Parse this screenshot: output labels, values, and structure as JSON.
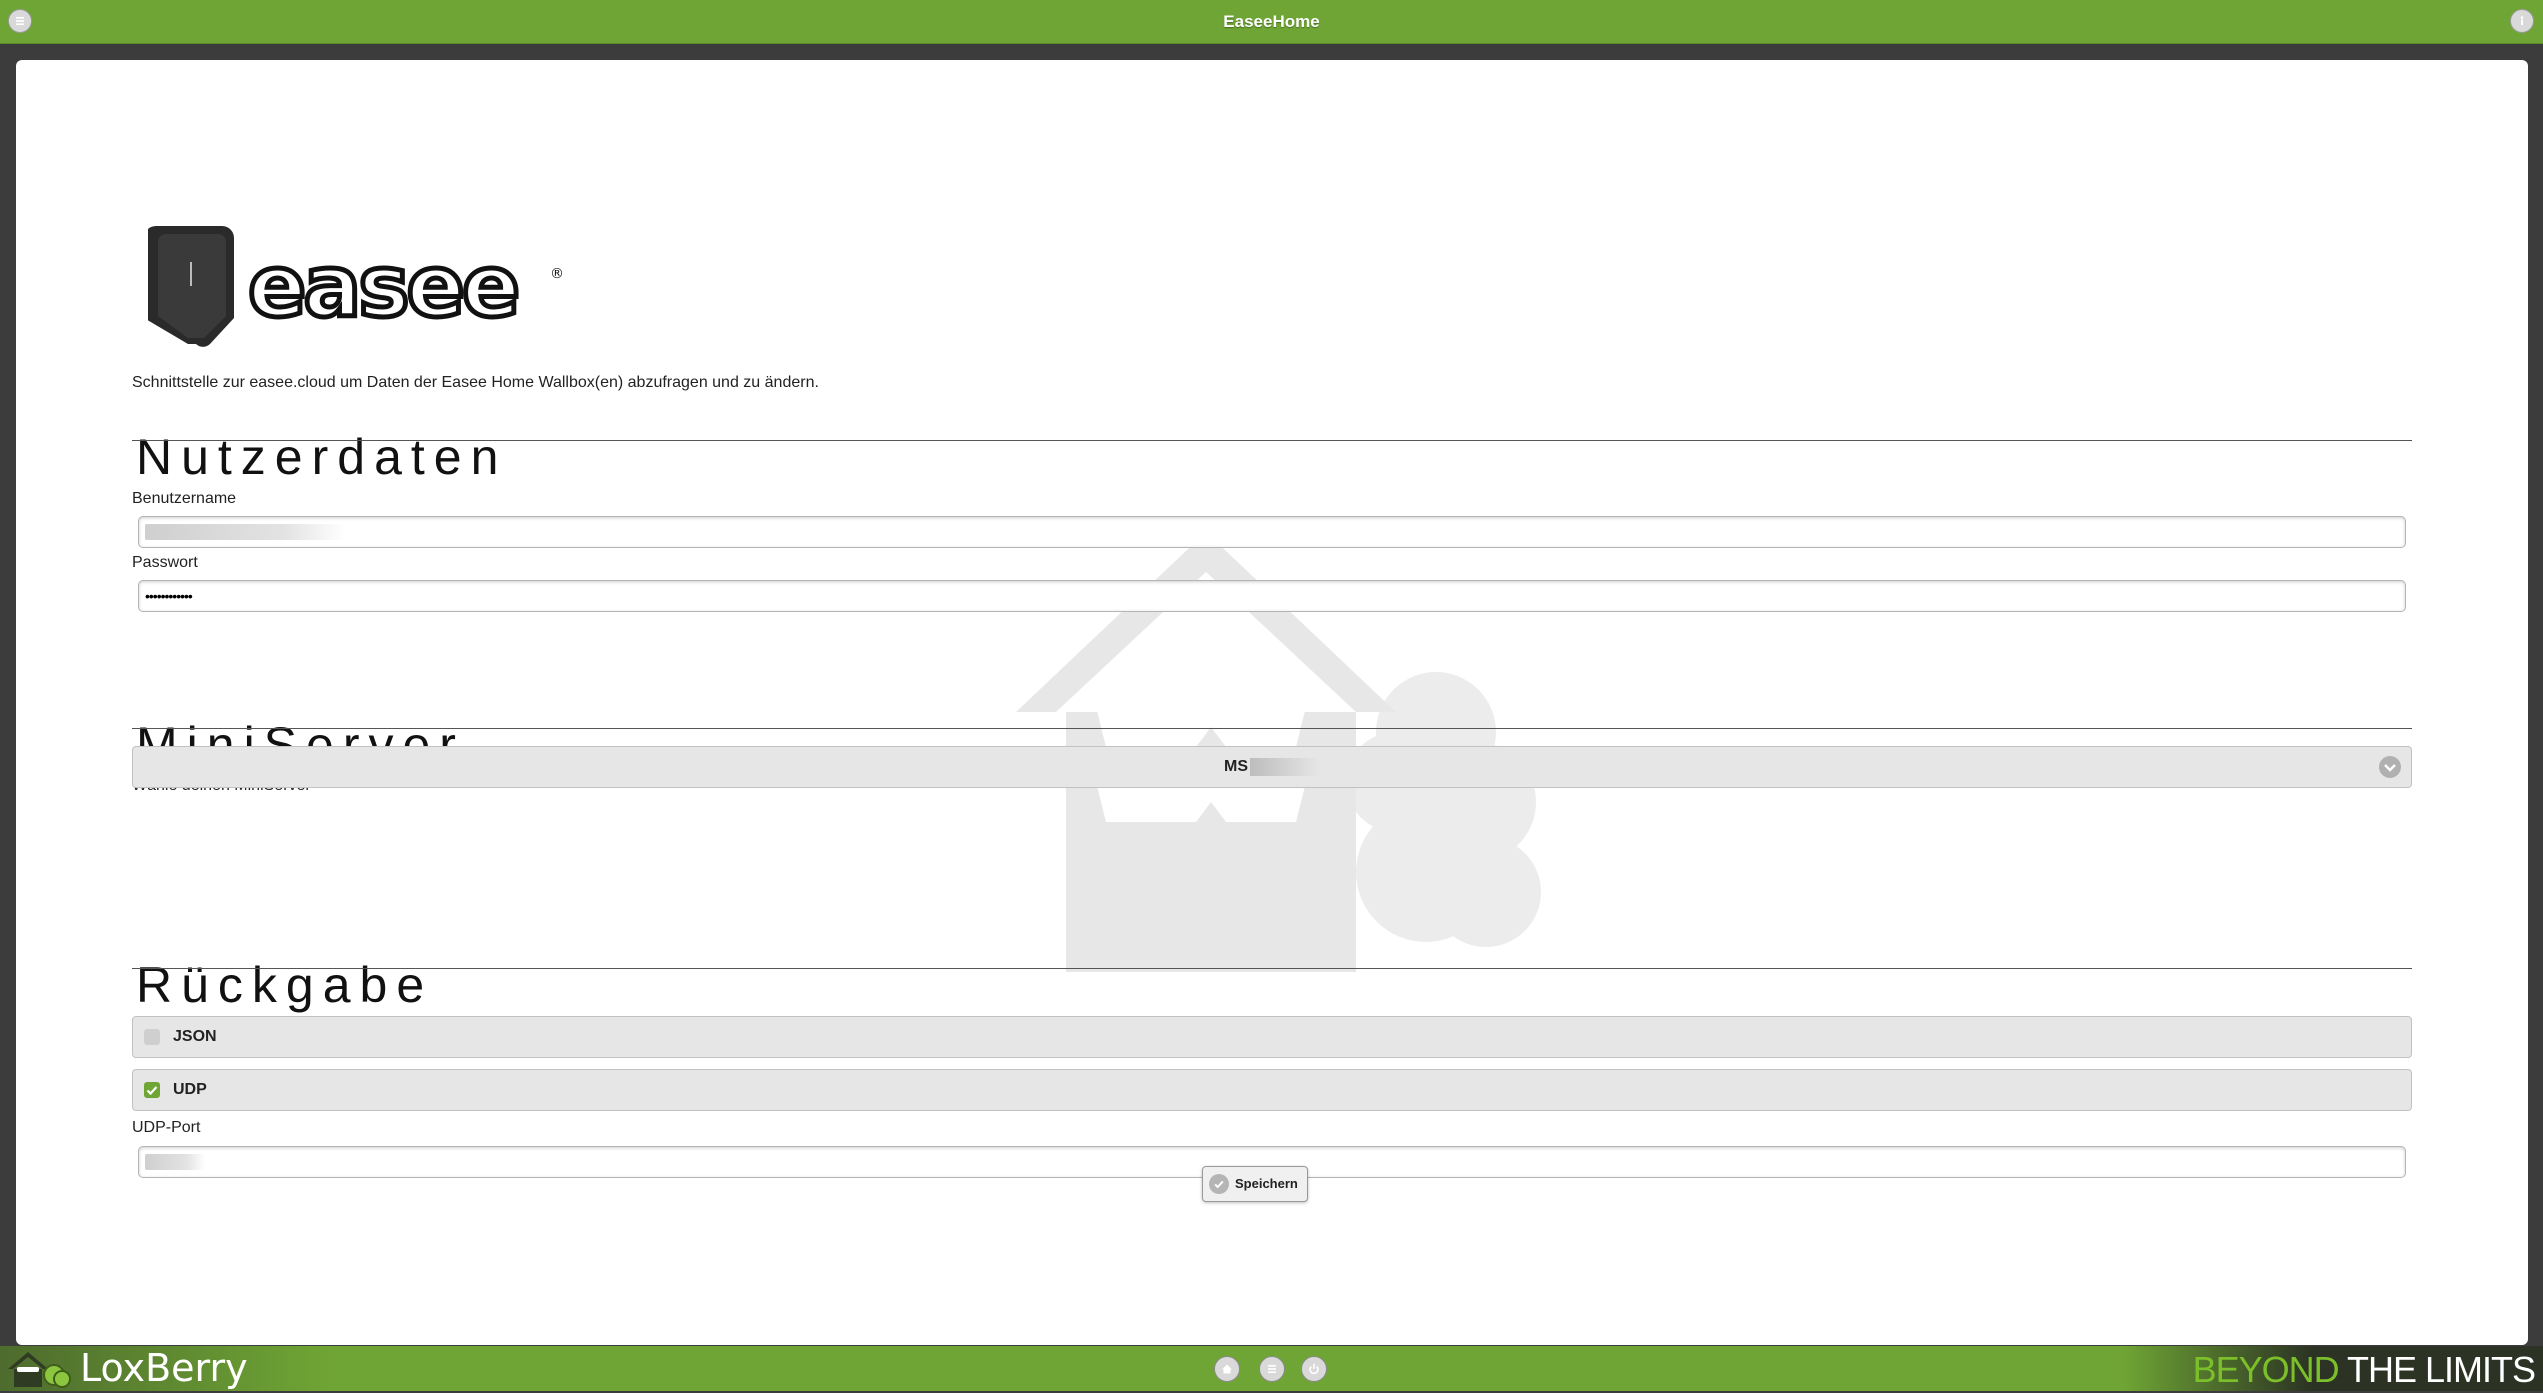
{
  "header": {
    "title": "EaseeHome",
    "menu_icon": "menu-icon",
    "info_icon": "info-icon"
  },
  "logo": {
    "text": "easee",
    "registered": "®"
  },
  "intro": "Schnittstelle zur easee.cloud um Daten der Easee Home Wallbox(en) abzufragen und zu ändern.",
  "sections": {
    "user": {
      "heading": "Nutzerdaten",
      "username_label": "Benutzername",
      "password_label": "Passwort",
      "password_value": "••••••••••••"
    },
    "miniserver": {
      "heading": "MiniServer",
      "select_label": "Wähle deinen MiniServer",
      "selected": "MS"
    },
    "return": {
      "heading": "Rückgabe",
      "json_label": "JSON",
      "json_checked": false,
      "udp_label": "UDP",
      "udp_checked": true,
      "udp_port_label": "UDP-Port"
    }
  },
  "save_label": "Speichern",
  "footer": {
    "brand": "LoxBerry",
    "slogan_a": "BEYOND",
    "slogan_b": " THE LIMITS",
    "nav_icons": [
      "home-icon",
      "menu-icon",
      "power-icon"
    ]
  },
  "colors": {
    "accent": "#6fa534",
    "check": "#6fa534"
  }
}
